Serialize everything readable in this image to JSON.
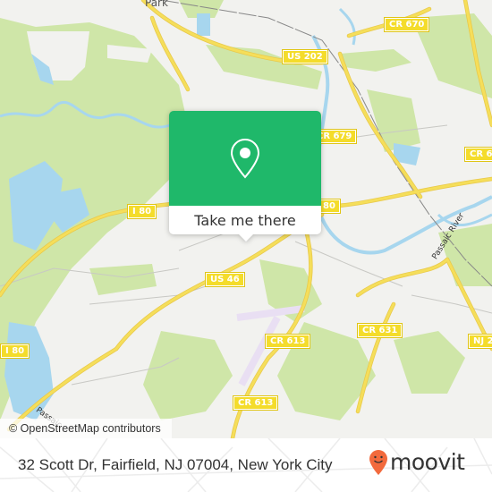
{
  "map": {
    "place_labels": [
      {
        "text": "Park"
      }
    ],
    "road_shields": [
      {
        "text": "CR 670"
      },
      {
        "text": "US 202"
      },
      {
        "text": "CR 679"
      },
      {
        "text": "CR 6"
      },
      {
        "text": "I 80"
      },
      {
        "text": "80"
      },
      {
        "text": "I 80"
      },
      {
        "text": "US 46"
      },
      {
        "text": "CR 613"
      },
      {
        "text": "CR 631"
      },
      {
        "text": "NJ 2"
      },
      {
        "text": "CR 613"
      }
    ],
    "river_labels": [
      {
        "text": "Passaic River"
      },
      {
        "text": "Passaic"
      }
    ],
    "colors": {
      "background": "#f2f2ef",
      "park": "#cfe6a8",
      "water": "#a7d6ee",
      "road": "#f5de5a",
      "airport": "#e9dff3"
    }
  },
  "popup": {
    "icon": "location-pin-icon",
    "action_label": "Take me there",
    "accent_color": "#1fb86a"
  },
  "attribution": {
    "text": "© OpenStreetMap contributors"
  },
  "footer": {
    "address": "32 Scott Dr, Fairfield, NJ 07004, New York City",
    "logo_text": "moovit",
    "logo_icon": "moovit-pin-icon",
    "logo_color": "#f26a3d"
  }
}
